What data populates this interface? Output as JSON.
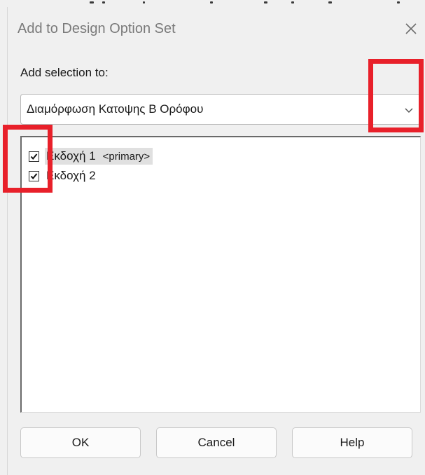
{
  "dialog": {
    "title": "Add to Design Option Set",
    "close_icon": "close-icon"
  },
  "selection": {
    "label": "Add selection to:",
    "value": "Διαμόρφωση Κατοψης Β Ορόφου",
    "dropdown_icon": "chevron-down-icon"
  },
  "options": [
    {
      "label": "Εκδοχή 1",
      "tag": "<primary>",
      "checked": true,
      "selected": true
    },
    {
      "label": "Εκδοχή 2",
      "tag": "",
      "checked": true,
      "selected": false
    }
  ],
  "buttons": {
    "ok": "OK",
    "cancel": "Cancel",
    "help": "Help"
  },
  "colors": {
    "highlight": "#e8202a",
    "background": "#f0f0f0"
  }
}
